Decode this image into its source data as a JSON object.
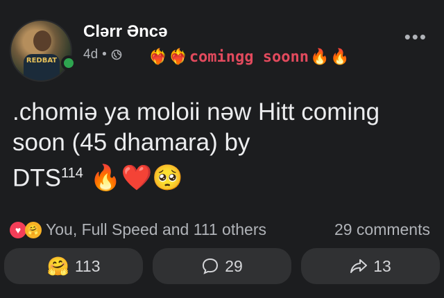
{
  "post": {
    "author": "Clərr Əncə",
    "age": "4d",
    "separator": "•",
    "feeling": "comingg soonn",
    "body_line1": ".chomiə ya moloii nəw Hitt coming",
    "body_line2": "soon (45 dhamara) by",
    "body_line3": "DTS",
    "body_sup": "114",
    "more": "•••",
    "avatar_shirt_text": "REDBAT"
  },
  "stats": {
    "reactions_text": "You, Full Speed and 111 others",
    "comments_text": "29 comments"
  },
  "actions": {
    "react_count": "113",
    "comment_count": "29",
    "share_count": "13"
  },
  "colors": {
    "online": "#2ea44f",
    "feeling_text": "#e24a5d"
  }
}
